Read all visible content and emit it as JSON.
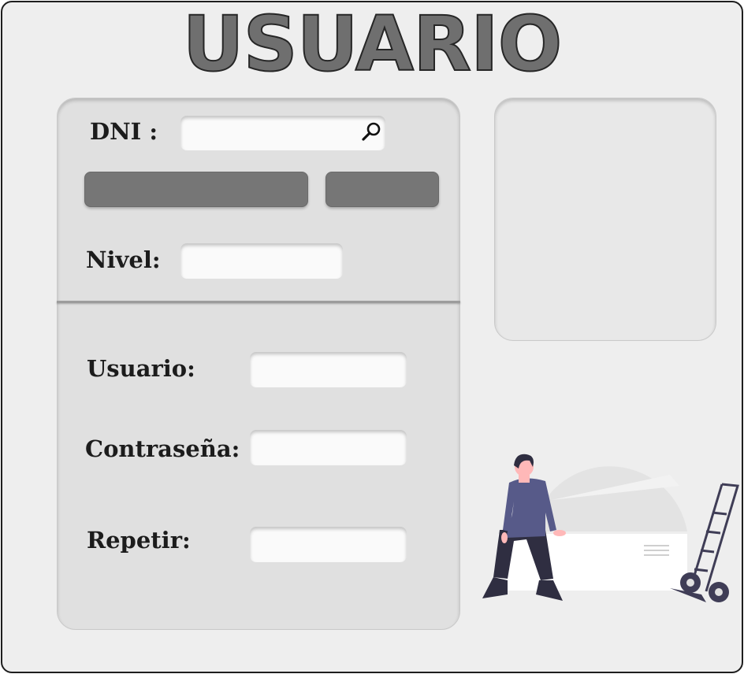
{
  "title": "USUARIO",
  "search": {
    "label": "DNI :",
    "value": "",
    "icon": "search-icon"
  },
  "buttons": {
    "primary_label": "",
    "secondary_label": ""
  },
  "fields": {
    "nivel": {
      "label": "Nivel:",
      "value": ""
    },
    "usuario": {
      "label": "Usuario:",
      "value": ""
    },
    "contrasena": {
      "label": "Contraseña:",
      "value": ""
    },
    "repetir": {
      "label": "Repetir:",
      "value": ""
    }
  },
  "colors": {
    "background": "#eeeeee",
    "panel": "#e0e0e0",
    "button": "#767676",
    "title_fill": "#6f6f6f",
    "accent_figure": "#575a89"
  }
}
